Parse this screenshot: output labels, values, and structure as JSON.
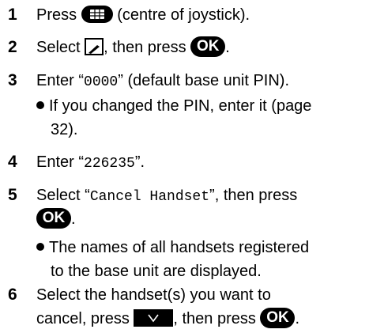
{
  "steps": [
    {
      "num": "1",
      "text_a": "Press ",
      "text_b": " (centre of joystick).",
      "icon": "menu-button-icon"
    },
    {
      "num": "2",
      "text_a": "Select ",
      "text_b": ", then press ",
      "icon": "menu-book-icon",
      "button": "OK"
    },
    {
      "num": "3",
      "text_a": "Enter “",
      "mono": "0000",
      "text_b": "” (default base unit PIN).",
      "bullets": [
        {
          "line1": "If you changed the PIN, enter it (page",
          "line2": "32)."
        }
      ]
    },
    {
      "num": "4",
      "text_a": "Enter “",
      "mono": "226235",
      "text_b": "”."
    },
    {
      "num": "5",
      "text_a": "Select “",
      "mono": "Cancel Handset",
      "text_b": "”, then press",
      "button": "OK",
      "bullets": [
        {
          "line1": "The names of all handsets registered",
          "line2": "to the base unit are displayed."
        }
      ]
    },
    {
      "num": "6",
      "line1": "Select the handset(s) you want to",
      "line2_a": "cancel, press ",
      "line2_b": ", then press ",
      "button": "OK",
      "soft_key_icon": "checkmark-icon"
    }
  ]
}
